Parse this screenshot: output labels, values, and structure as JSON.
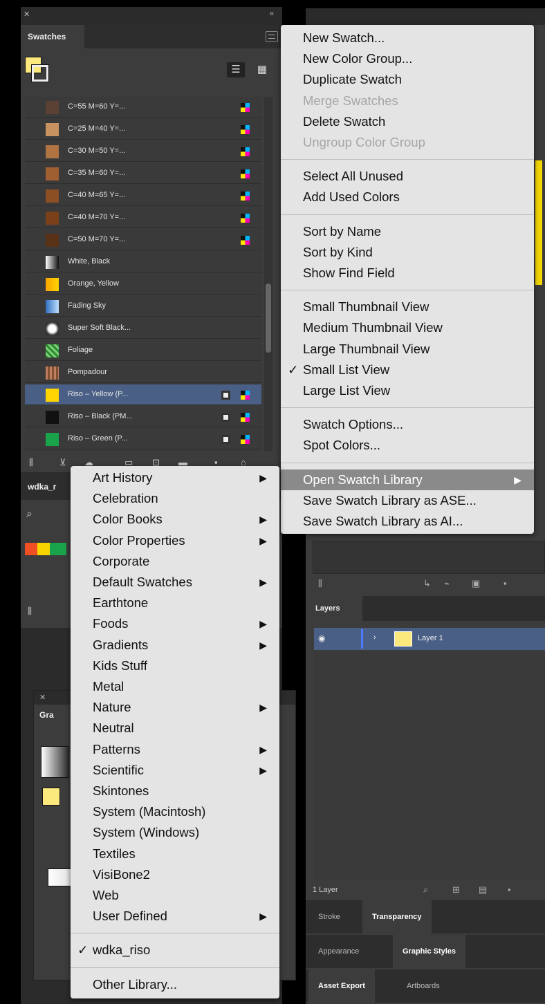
{
  "swatches_panel": {
    "tab": "Swatches",
    "rows": [
      {
        "label": "C=55 M=60 Y=...",
        "chip": "#5a4134",
        "type": "process"
      },
      {
        "label": "C=25 M=40 Y=...",
        "chip": "#c89160",
        "type": "process"
      },
      {
        "label": "C=30 M=50 Y=...",
        "chip": "#b07443",
        "type": "process"
      },
      {
        "label": "C=35 M=60 Y=...",
        "chip": "#a05f30",
        "type": "process"
      },
      {
        "label": "C=40 M=65 Y=...",
        "chip": "#8c4f24",
        "type": "process"
      },
      {
        "label": "C=40 M=70 Y=...",
        "chip": "#7a4019",
        "type": "process"
      },
      {
        "label": "C=50 M=70 Y=...",
        "chip": "#5a3218",
        "type": "process"
      },
      {
        "label": "White, Black",
        "chip": "linear-gradient(90deg,#fff,#111)",
        "type": "gradient"
      },
      {
        "label": "Orange, Yellow",
        "chip": "linear-gradient(90deg,#f7a400,#ffd400)",
        "type": "gradient"
      },
      {
        "label": "Fading Sky",
        "chip": "linear-gradient(90deg,#2f6fbf,#bfe0ff)",
        "type": "gradient"
      },
      {
        "label": "Super Soft Black...",
        "chip": "radial-gradient(circle,#fff 40%,#333 70%)",
        "type": "gradient"
      },
      {
        "label": "Foliage",
        "chip": "repeating-linear-gradient(45deg,#2e8b2e 0 3px,#7fd37f 3px 6px)",
        "type": "pattern"
      },
      {
        "label": "Pompadour",
        "chip": "repeating-linear-gradient(90deg,#c08060 0 3px,#805030 3px 6px)",
        "type": "pattern"
      },
      {
        "label": "Riso – Yellow (P...",
        "chip": "#ffd400",
        "type": "spot",
        "selected": true
      },
      {
        "label": "Riso – Black (PM...",
        "chip": "#111111",
        "type": "spot"
      },
      {
        "label": "Riso – Green (P...",
        "chip": "#19a34a",
        "type": "spot"
      }
    ],
    "library_tab": "wdka_r"
  },
  "panel_menu": {
    "items": [
      {
        "label": "New Swatch...",
        "state": "enabled"
      },
      {
        "label": "New Color Group...",
        "state": "enabled"
      },
      {
        "label": "Duplicate Swatch",
        "state": "enabled"
      },
      {
        "label": "Merge Swatches",
        "state": "disabled"
      },
      {
        "label": "Delete Swatch",
        "state": "enabled"
      },
      {
        "label": "Ungroup Color Group",
        "state": "disabled"
      },
      {
        "label": "Select All Unused",
        "state": "enabled"
      },
      {
        "label": "Add Used Colors",
        "state": "enabled"
      },
      {
        "label": "Sort by Name",
        "state": "enabled"
      },
      {
        "label": "Sort by Kind",
        "state": "enabled"
      },
      {
        "label": "Show Find Field",
        "state": "enabled"
      },
      {
        "label": "Small Thumbnail View",
        "state": "enabled"
      },
      {
        "label": "Medium Thumbnail View",
        "state": "enabled"
      },
      {
        "label": "Large Thumbnail View",
        "state": "enabled"
      },
      {
        "label": "Small List View",
        "state": "enabled",
        "checked": true
      },
      {
        "label": "Large List View",
        "state": "enabled"
      },
      {
        "label": "Swatch Options...",
        "state": "enabled"
      },
      {
        "label": "Spot Colors...",
        "state": "enabled"
      },
      {
        "label": "Open Swatch Library",
        "state": "highlighted",
        "submenu": true
      },
      {
        "label": "Save Swatch Library as ASE...",
        "state": "enabled"
      },
      {
        "label": "Save Swatch Library as AI...",
        "state": "enabled"
      }
    ]
  },
  "library_submenu": {
    "items": [
      {
        "label": "Art History",
        "submenu": true
      },
      {
        "label": "Celebration",
        "submenu": false
      },
      {
        "label": "Color Books",
        "submenu": true
      },
      {
        "label": "Color Properties",
        "submenu": true
      },
      {
        "label": "Corporate",
        "submenu": false
      },
      {
        "label": "Default Swatches",
        "submenu": true
      },
      {
        "label": "Earthtone",
        "submenu": false
      },
      {
        "label": "Foods",
        "submenu": true
      },
      {
        "label": "Gradients",
        "submenu": true
      },
      {
        "label": "Kids Stuff",
        "submenu": false
      },
      {
        "label": "Metal",
        "submenu": false
      },
      {
        "label": "Nature",
        "submenu": true
      },
      {
        "label": "Neutral",
        "submenu": false
      },
      {
        "label": "Patterns",
        "submenu": true
      },
      {
        "label": "Scientific",
        "submenu": true
      },
      {
        "label": "Skintones",
        "submenu": false
      },
      {
        "label": "System (Macintosh)",
        "submenu": false
      },
      {
        "label": "System (Windows)",
        "submenu": false
      },
      {
        "label": "Textiles",
        "submenu": false
      },
      {
        "label": "VisiBone2",
        "submenu": false
      },
      {
        "label": "Web",
        "submenu": false
      },
      {
        "label": "User Defined",
        "submenu": true
      },
      {
        "label": "wdka_riso",
        "checked": true
      },
      {
        "label": "Other Library..."
      }
    ]
  },
  "gradient_panel": {
    "tab": "Gra"
  },
  "layers_panel": {
    "tab": "Layers",
    "layer_name": "Layer 1",
    "footer_count": "1 Layer"
  },
  "tab_groups": {
    "row1": [
      "Stroke",
      "Transparency"
    ],
    "row2": [
      "Appearance",
      "Graphic Styles"
    ],
    "row3": [
      "Asset Export",
      "Artboards"
    ]
  },
  "colors": {
    "panel_bg": "#3c3c3c",
    "selection": "#4a5f85",
    "menu_bg": "#e4e4e4",
    "menu_highlight": "#8a8a8a",
    "fill_color": "#fbe97e"
  }
}
